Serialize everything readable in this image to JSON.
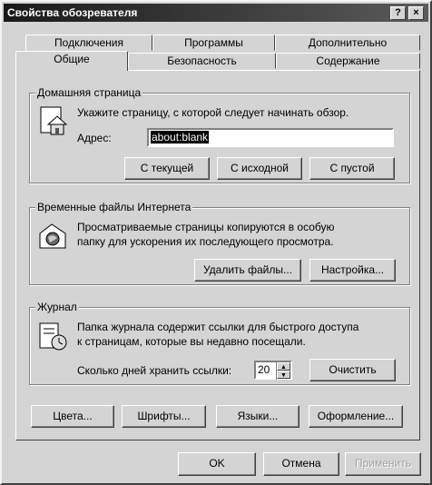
{
  "window": {
    "title": "Свойства обозревателя",
    "help_label": "?",
    "close_label": "×"
  },
  "tabs": {
    "row1": [
      "Подключения",
      "Программы",
      "Дополнительно"
    ],
    "row2": [
      "Общие",
      "Безопасность",
      "Содержание"
    ],
    "active": "Общие"
  },
  "home": {
    "title": "Домашняя страница",
    "instruction": "Укажите страницу, с которой следует начинать обзор.",
    "address_label": "Адрес:",
    "address_value": "about:blank",
    "btn_current": "С текущей",
    "btn_default": "С исходной",
    "btn_blank": "С пустой"
  },
  "temp": {
    "title": "Временные файлы Интернета",
    "desc_line1": "Просматриваемые страницы копируются в особую",
    "desc_line2": "папку для ускорения их последующего просмотра.",
    "btn_delete": "Удалить файлы...",
    "btn_settings": "Настройка..."
  },
  "history": {
    "title": "Журнал",
    "desc_line1": "Папка журнала содержит ссылки для быстрого доступа",
    "desc_line2": "к страницам, которые вы недавно посещали.",
    "days_label": "Сколько дней хранить ссылки:",
    "days_value": "20",
    "btn_clear": "Очистить"
  },
  "bottom_buttons": {
    "colors": "Цвета...",
    "fonts": "Шрифты...",
    "languages": "Языки...",
    "accessibility": "Оформление..."
  },
  "dialog_buttons": {
    "ok": "OK",
    "cancel": "Отмена",
    "apply": "Применить"
  }
}
